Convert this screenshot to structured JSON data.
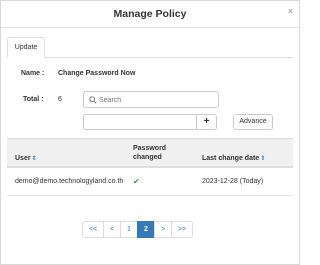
{
  "modal": {
    "title": "Manage Policy",
    "close_icon": "×"
  },
  "tabs": [
    {
      "label": "Update"
    }
  ],
  "policy": {
    "name_label": "Name :",
    "name_value": "Change Password Now",
    "total_label": "Total :",
    "total_value": "6"
  },
  "search": {
    "placeholder": "Search",
    "value": ""
  },
  "filter": {
    "value": "",
    "plus_label": "+"
  },
  "advance_label": "Advance",
  "table": {
    "columns": [
      {
        "label": "User",
        "sortable": true
      },
      {
        "label": "Password changed",
        "sortable": false
      },
      {
        "label": "Last change date",
        "sortable": true
      }
    ],
    "rows": [
      {
        "user": "demo@demo.technologyland.co.th",
        "password_changed_icon": "✔",
        "last_change": "2023-12-28 (Today)"
      }
    ]
  },
  "pagination": {
    "first": "<<",
    "prev": "<",
    "pages": [
      "1",
      "2"
    ],
    "active_page": "2",
    "next": ">",
    "last": ">>"
  },
  "colors": {
    "accent": "#337ab7",
    "check": "#3c9a3c",
    "header_bg": "#f0f0f0"
  },
  "icons": {
    "sort": "⇕",
    "search": "search-icon",
    "close": "close-icon",
    "check": "check-icon"
  }
}
